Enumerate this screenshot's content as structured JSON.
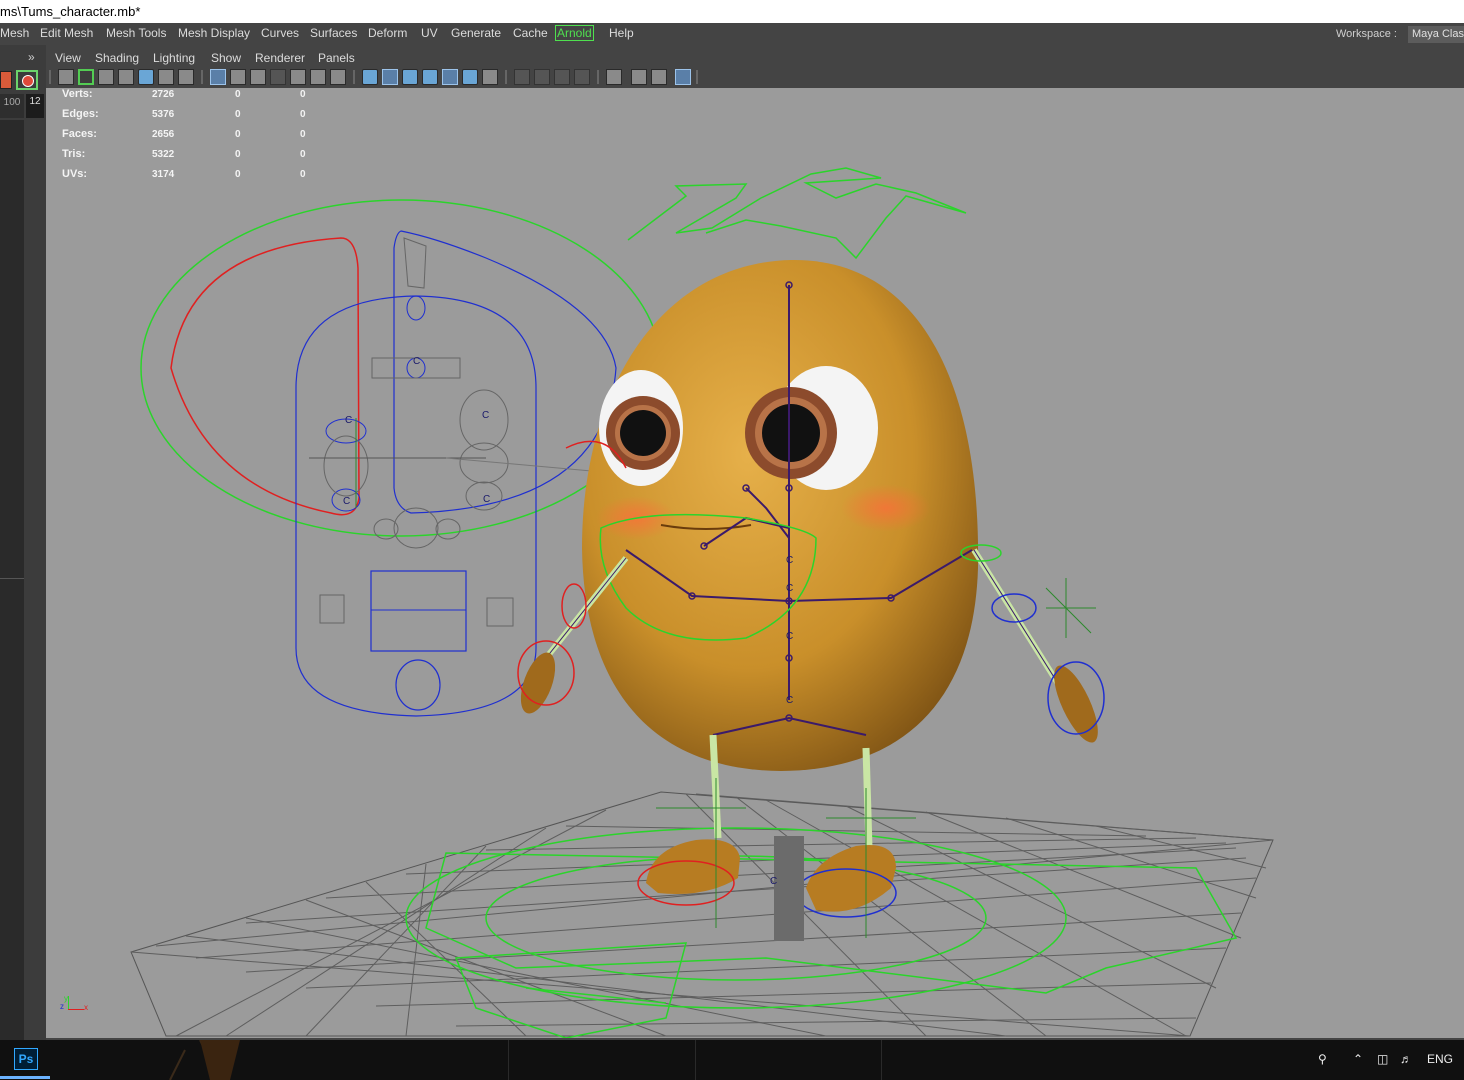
{
  "window": {
    "title": "ms\\Tums_character.mb*"
  },
  "menubar": {
    "items": [
      "Mesh",
      "Edit Mesh",
      "Mesh Tools",
      "Mesh Display",
      "Curves",
      "Surfaces",
      "Deform",
      "UV",
      "Generate",
      "Cache",
      "Arnold",
      "Help"
    ]
  },
  "workspace": {
    "label": "Workspace :",
    "value": "Maya Clas"
  },
  "panel_menu": {
    "items": [
      "View",
      "Shading",
      "Lighting",
      "Show",
      "Renderer",
      "Panels"
    ]
  },
  "side": {
    "collapse_glyph": "»",
    "frame_start": "100",
    "frame_current": "12"
  },
  "hud": {
    "rows": [
      {
        "label": "Verts:",
        "v1": "2726",
        "v2": "0",
        "v3": "0"
      },
      {
        "label": "Edges:",
        "v1": "5376",
        "v2": "0",
        "v3": "0"
      },
      {
        "label": "Faces:",
        "v1": "2656",
        "v2": "0",
        "v3": "0"
      },
      {
        "label": "Tris:",
        "v1": "5322",
        "v2": "0",
        "v3": "0"
      },
      {
        "label": "UVs:",
        "v1": "3174",
        "v2": "0",
        "v3": "0"
      }
    ]
  },
  "axis": {
    "y": "y",
    "z": "z",
    "x": "x"
  },
  "taskbar": {
    "app": "Ps",
    "language": "ENG"
  },
  "colors": {
    "menu_bg": "#444444",
    "viewport_bg": "#9b9b9b",
    "arnold_accent": "#4fe04f",
    "control_green": "#2bd42b",
    "control_red": "#e02020",
    "control_blue": "#1f2fd0",
    "potato": "#c98f2a"
  },
  "icons": [
    "hud-toggle-icon",
    "camera-icon",
    "select-camera-icon",
    "lock-camera-icon",
    "bookmark-icon",
    "image-plane-icon",
    "grid-icon",
    "film-gate-icon",
    "resolution-gate-icon",
    "gate-mask-icon",
    "field-chart-icon",
    "safe-action-icon",
    "safe-title-icon",
    "wireframe-icon",
    "smooth-shade-icon",
    "wireframe-on-shaded-icon",
    "default-material-icon",
    "xray-icon",
    "isolate-select-icon",
    "lighting-icon",
    "shadows-icon",
    "screen-space-ao-icon",
    "motion-blur-icon",
    "multisample-aa-icon",
    "depth-of-field-icon",
    "isolate-icon",
    "xray-joints-icon",
    "xray-active-icon",
    "hud-icon",
    "photoshop-icon",
    "people-icon",
    "chevron-up-icon",
    "network-icon",
    "speaker-icon"
  ]
}
